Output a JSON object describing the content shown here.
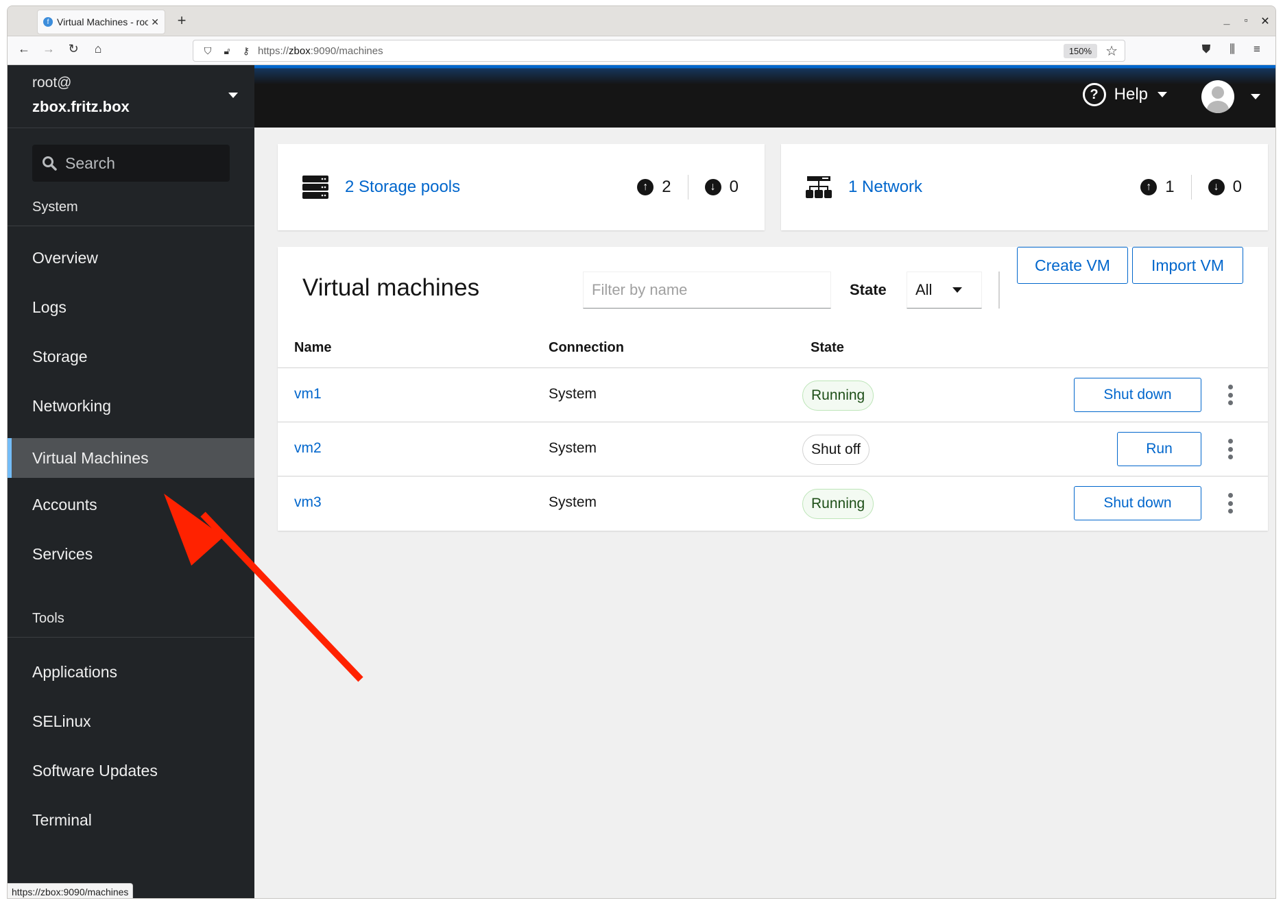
{
  "browser": {
    "tab_title": "Virtual Machines - root@zbox",
    "new_tab": "+",
    "url_prefix": "https://",
    "url_host": "zbox",
    "url_rest": ":9090/machines",
    "zoom": "150%",
    "status_url": "https://zbox:9090/machines"
  },
  "sidebar": {
    "user": "root@",
    "host": "zbox.fritz.box",
    "search_placeholder": "Search",
    "section_system": "System",
    "system_items": [
      {
        "label": "Overview"
      },
      {
        "label": "Logs"
      },
      {
        "label": "Storage"
      },
      {
        "label": "Networking"
      },
      {
        "label": "Virtual Machines",
        "active": true
      },
      {
        "label": "Accounts"
      },
      {
        "label": "Services"
      }
    ],
    "section_tools": "Tools",
    "tools_items": [
      {
        "label": "Applications"
      },
      {
        "label": "SELinux"
      },
      {
        "label": "Software Updates"
      },
      {
        "label": "Terminal"
      }
    ]
  },
  "topbar": {
    "help_label": "Help"
  },
  "summary": {
    "storage": {
      "label": "2 Storage pools",
      "up": "2",
      "down": "0"
    },
    "network": {
      "label": "1 Network",
      "up": "1",
      "down": "0"
    }
  },
  "vms": {
    "title": "Virtual machines",
    "filter_placeholder": "Filter by name",
    "state_label": "State",
    "state_value": "All",
    "create_label": "Create VM",
    "import_label": "Import VM",
    "columns": [
      "Name",
      "Connection",
      "State"
    ],
    "rows": [
      {
        "name": "vm1",
        "connection": "System",
        "state": "Running",
        "action": "Shut down"
      },
      {
        "name": "vm2",
        "connection": "System",
        "state": "Shut off",
        "action": "Run"
      },
      {
        "name": "vm3",
        "connection": "System",
        "state": "Running",
        "action": "Shut down"
      }
    ]
  },
  "colors": {
    "accent": "#0066cc",
    "sidebar_bg": "#212427",
    "active_marker": "#73bcf7",
    "annotation_arrow": "#ff2200"
  }
}
